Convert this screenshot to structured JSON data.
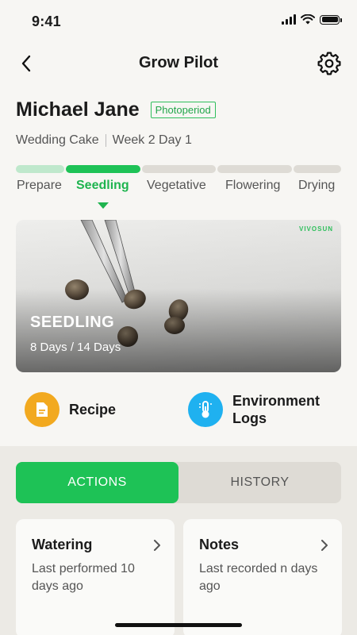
{
  "status_bar": {
    "time": "9:41"
  },
  "header": {
    "title": "Grow Pilot",
    "back_icon": "chevron-left-icon",
    "settings_icon": "gear-icon"
  },
  "plant": {
    "name": "Michael Jane",
    "type_badge": "Photoperiod",
    "strain": "Wedding Cake",
    "week_day": "Week 2 Day 1"
  },
  "stages": {
    "active_index": 1,
    "items": [
      {
        "label": "Prepare",
        "status": "complete"
      },
      {
        "label": "Seedling",
        "status": "active"
      },
      {
        "label": "Vegetative",
        "status": "upcoming"
      },
      {
        "label": "Flowering",
        "status": "upcoming"
      },
      {
        "label": "Drying",
        "status": "upcoming"
      }
    ],
    "colors": {
      "complete": "#bfe8cc",
      "active": "#1ec256",
      "upcoming": "#dedbd5"
    }
  },
  "hero": {
    "brand": "VIVOSUN",
    "stage_title": "SEEDLING",
    "days_text": "8 Days / 14 Days",
    "days_elapsed": 8,
    "days_total": 14
  },
  "quick_links": {
    "recipe": {
      "label": "Recipe",
      "icon": "document-icon",
      "color": "#f2a91f"
    },
    "environment_logs": {
      "label_line1": "Environment",
      "label_line2": "Logs",
      "icon": "thermometer-icon",
      "color": "#1fb1f0"
    }
  },
  "tabs": {
    "actions": "ACTIONS",
    "history": "HISTORY",
    "selected": "ACTIONS"
  },
  "cards": {
    "watering": {
      "title": "Watering",
      "desc": "Last performed 10 days ago"
    },
    "notes": {
      "title": "Notes",
      "desc": "Last recorded n days ago"
    }
  }
}
